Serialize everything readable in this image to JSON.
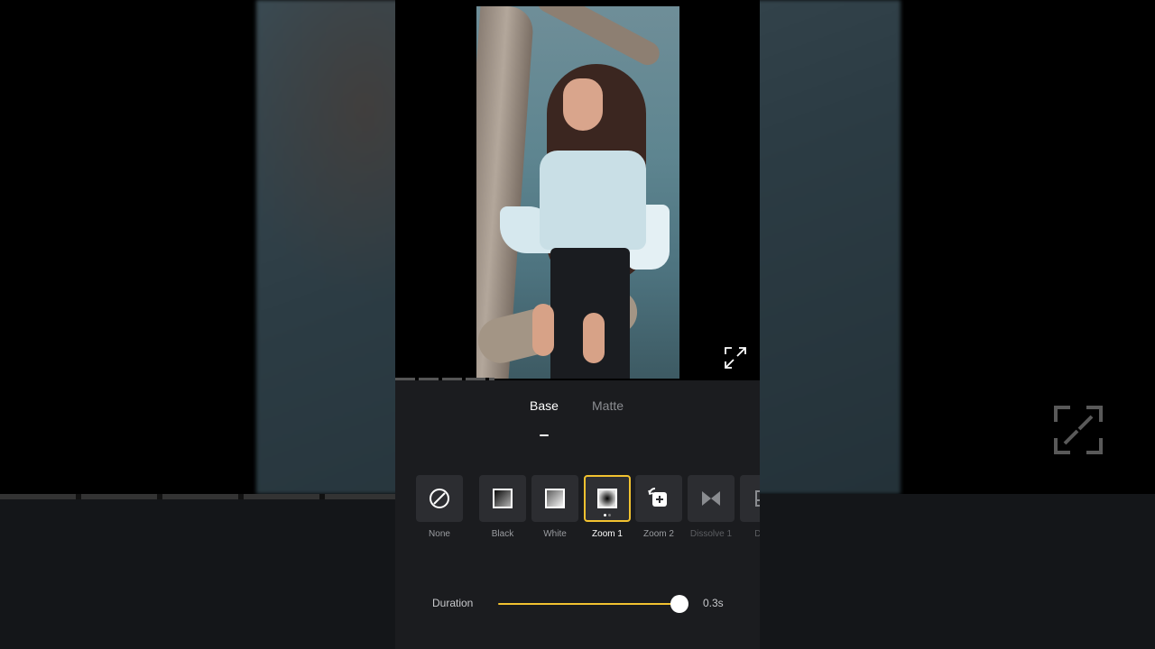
{
  "tabs": [
    {
      "label": "Base",
      "active": true
    },
    {
      "label": "Matte",
      "active": false
    }
  ],
  "transitions": [
    {
      "label": "None",
      "icon": "none-icon"
    },
    {
      "label": "Black",
      "icon": "black-fade-icon"
    },
    {
      "label": "White",
      "icon": "white-fade-icon"
    },
    {
      "label": "Zoom 1",
      "icon": "zoom-in-icon",
      "selected": true
    },
    {
      "label": "Zoom 2",
      "icon": "zoom-out-icon"
    },
    {
      "label": "Dissolve 1",
      "icon": "dissolve-icon"
    },
    {
      "label": "Diss",
      "icon": "dissolve-icon"
    }
  ],
  "duration": {
    "label": "Duration",
    "value": "0.3s",
    "level_percent": 100
  },
  "colors": {
    "accent": "#f2c230",
    "panel": "#1b1c1f",
    "tile": "#2c2d31"
  }
}
